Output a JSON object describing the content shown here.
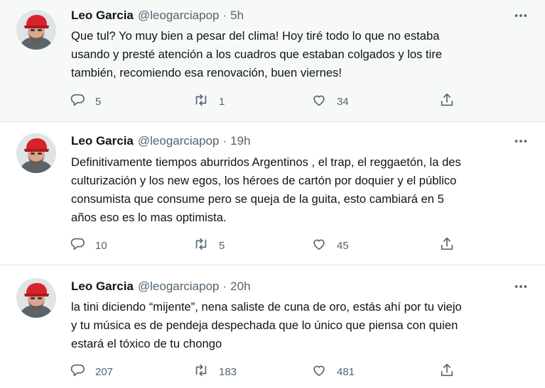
{
  "tweets": [
    {
      "name": "Leo Garcia",
      "handle": "@leogarciapop",
      "separator": "·",
      "time": "5h",
      "text": "Que tul? Yo muy bien a pesar del clima! Hoy tiré todo lo que no estaba\nusando y presté atención a los cuadros que estaban colgados y los tire\ntambién, recomiendo esa renovación, buen viernes!",
      "replies": "5",
      "retweets": "1",
      "likes": "34"
    },
    {
      "name": "Leo Garcia",
      "handle": "@leogarciapop",
      "separator": "·",
      "time": "19h",
      "text": "Definitivamente tiempos aburridos Argentinos , el trap, el reggaetón, la des\nculturización y los new egos, los héroes de cartón por doquier y el público\nconsumista que consume pero se queja de la guita, esto cambiará en 5\naños eso es lo mas optimista.",
      "replies": "10",
      "retweets": "5",
      "likes": "45"
    },
    {
      "name": "Leo Garcia",
      "handle": "@leogarciapop",
      "separator": "·",
      "time": "20h",
      "text": "la tini diciendo “mijente”, nena saliste de cuna de oro, estás ahí por tu viejo\ny tu música es de pendeja despechada que lo único que piensa con quien\nestará el tóxico de tu chongo",
      "replies": "207",
      "retweets": "183",
      "likes": "481"
    }
  ],
  "icons": {
    "more": "more-icon",
    "reply": "reply-icon",
    "retweet": "retweet-icon",
    "like": "heart-icon",
    "share": "share-icon"
  },
  "colors": {
    "text": "#0f1419",
    "secondary": "#536471",
    "hover_background": "#f7f9f9",
    "avatar_cap": "#d8222b"
  }
}
